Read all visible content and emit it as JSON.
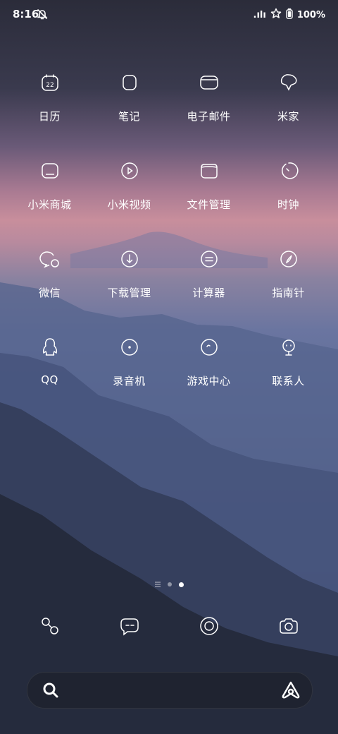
{
  "status_bar": {
    "time": "8:16",
    "signal_text": ".ılı",
    "battery_text": "100%"
  },
  "apps": [
    {
      "label": "日历",
      "icon": "calendar-icon",
      "day": "22"
    },
    {
      "label": "笔记",
      "icon": "notes-icon"
    },
    {
      "label": "电子邮件",
      "icon": "email-icon"
    },
    {
      "label": "米家",
      "icon": "mijia-icon"
    },
    {
      "label": "小米商城",
      "icon": "mall-icon"
    },
    {
      "label": "小米视频",
      "icon": "video-icon"
    },
    {
      "label": "文件管理",
      "icon": "folder-icon"
    },
    {
      "label": "时钟",
      "icon": "clock-icon"
    },
    {
      "label": "微信",
      "icon": "wechat-icon"
    },
    {
      "label": "下载管理",
      "icon": "download-icon"
    },
    {
      "label": "计算器",
      "icon": "calculator-icon"
    },
    {
      "label": "指南针",
      "icon": "compass-icon"
    },
    {
      "label": "QQ",
      "icon": "qq-icon"
    },
    {
      "label": "录音机",
      "icon": "recorder-icon"
    },
    {
      "label": "游戏中心",
      "icon": "game-center-icon"
    },
    {
      "label": "联系人",
      "icon": "contacts-icon"
    }
  ],
  "page_indicator": {
    "pages": 3,
    "active": 3
  },
  "dock": [
    {
      "icon": "phone-icon"
    },
    {
      "icon": "messages-icon"
    },
    {
      "icon": "browser-icon"
    },
    {
      "icon": "camera-icon"
    }
  ],
  "search_bar": {
    "icon": "search-icon",
    "assistant_icon": "ai-assistant-icon"
  }
}
